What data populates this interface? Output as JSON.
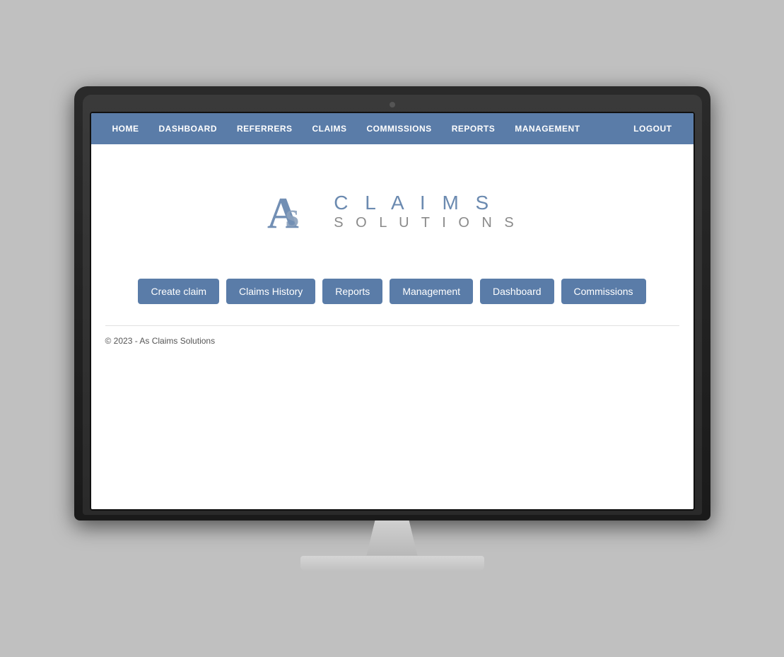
{
  "navbar": {
    "links": [
      {
        "label": "HOME",
        "name": "nav-home"
      },
      {
        "label": "DASHBOARD",
        "name": "nav-dashboard"
      },
      {
        "label": "REFERRERS",
        "name": "nav-referrers"
      },
      {
        "label": "CLAIMS",
        "name": "nav-claims"
      },
      {
        "label": "COMMISSIONS",
        "name": "nav-commissions"
      },
      {
        "label": "REPORTS",
        "name": "nav-reports"
      },
      {
        "label": "MANAGEMENT",
        "name": "nav-management"
      }
    ],
    "logout_label": "LOGOUT"
  },
  "logo": {
    "claims_text": "C L A I M S",
    "solutions_text": "S O L U T I O N S"
  },
  "action_buttons": [
    {
      "label": "Create claim",
      "name": "create-claim-button"
    },
    {
      "label": "Claims History",
      "name": "claims-history-button"
    },
    {
      "label": "Reports",
      "name": "reports-button"
    },
    {
      "label": "Management",
      "name": "management-button"
    },
    {
      "label": "Dashboard",
      "name": "dashboard-button"
    },
    {
      "label": "Commissions",
      "name": "commissions-button"
    }
  ],
  "footer": {
    "copyright": "© 2023 - As Claims Solutions"
  }
}
